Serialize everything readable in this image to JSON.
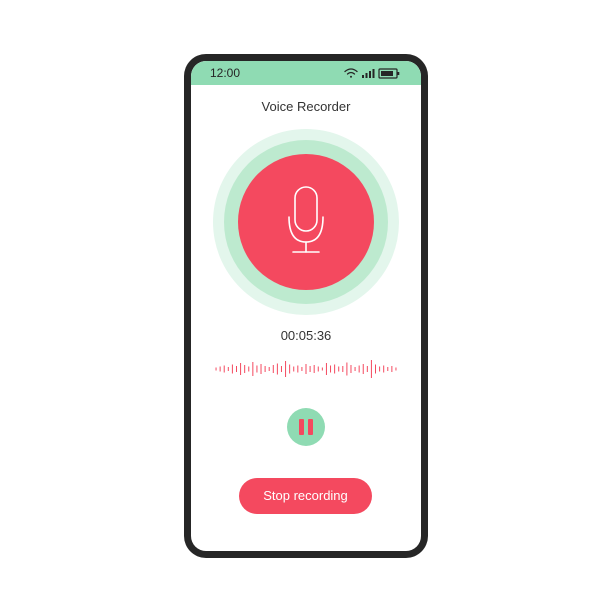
{
  "status_bar": {
    "time": "12:00",
    "icons": [
      "wifi-icon",
      "signal-icon",
      "battery-icon"
    ]
  },
  "app": {
    "title": "Voice Recorder"
  },
  "recorder": {
    "timer": "00:05:36",
    "mic_icon": "microphone-icon",
    "pause_icon": "pause-icon",
    "stop_label": "Stop recording"
  },
  "colors": {
    "accent_green": "#8fdbb3",
    "accent_red": "#f4495f",
    "phone_frame": "#262626"
  }
}
